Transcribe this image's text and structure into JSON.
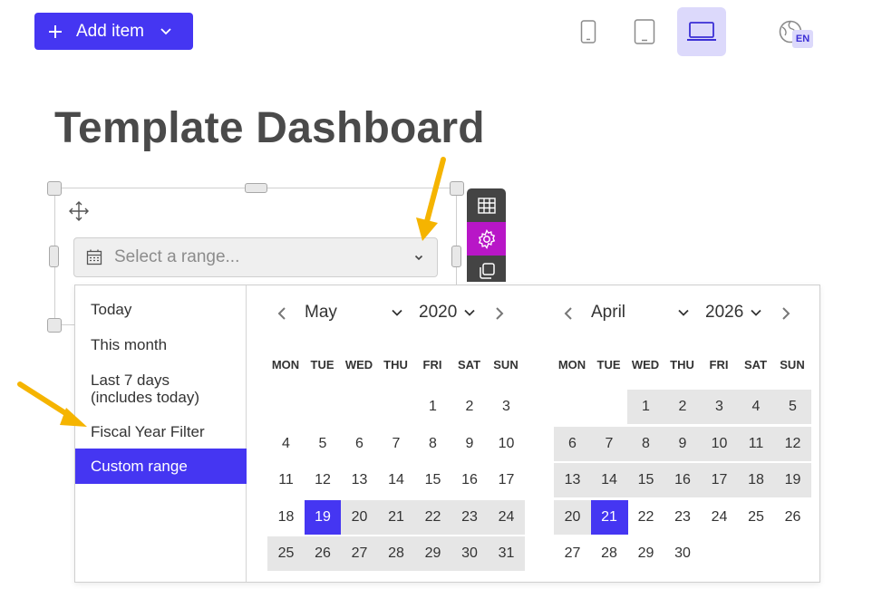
{
  "toolbar": {
    "add_item_label": "Add item",
    "language_badge": "EN"
  },
  "page": {
    "title": "Template Dashboard"
  },
  "date_filter": {
    "placeholder": "Select a range..."
  },
  "presets": [
    {
      "label": "Today"
    },
    {
      "label": "This month"
    },
    {
      "label": "Last 7 days"
    },
    {
      "label": "(includes today)"
    },
    {
      "label": "Fiscal Year Filter"
    },
    {
      "label": "Custom range",
      "active": true
    }
  ],
  "weekdays": [
    "MON",
    "TUE",
    "WED",
    "THU",
    "FRI",
    "SAT",
    "SUN"
  ],
  "calendars": [
    {
      "month": "May",
      "year": "2020",
      "first_weekday": 4,
      "days": 31,
      "selected": 19,
      "range_from": 19,
      "range_to": 31
    },
    {
      "month": "April",
      "year": "2026",
      "first_weekday": 2,
      "days": 30,
      "selected": 21,
      "range_from": 1,
      "range_to": 21
    }
  ],
  "colors": {
    "accent": "#4536f2",
    "accent_light": "#dcd9fb",
    "range_bg": "#e6e6e6",
    "tool_highlight": "#b816c7"
  }
}
